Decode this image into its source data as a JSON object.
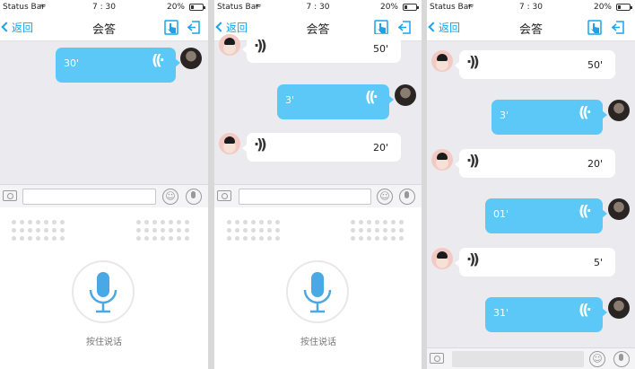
{
  "status_bar": {
    "carrier": "Status Bar",
    "time": "7 : 30",
    "battery": "20%"
  },
  "nav": {
    "back": "返回",
    "title": "会答"
  },
  "screen1": {
    "messages": [
      {
        "side": "self",
        "duration": "30'"
      }
    ]
  },
  "screen2": {
    "messages": [
      {
        "side": "other",
        "duration": "50'"
      },
      {
        "side": "self",
        "duration": "3'"
      },
      {
        "side": "other",
        "duration": "20'"
      }
    ]
  },
  "screen3": {
    "messages": [
      {
        "side": "other",
        "duration": "50'"
      },
      {
        "side": "self",
        "duration": "3'"
      },
      {
        "side": "other",
        "duration": "20'"
      },
      {
        "side": "self",
        "duration": "01'"
      },
      {
        "side": "other",
        "duration": "5'"
      },
      {
        "side": "self",
        "duration": "31'"
      }
    ]
  },
  "voice_panel": {
    "hold_to_talk": "按住说话"
  },
  "icons": {
    "hand": "hand-pointer-icon",
    "exit": "exit-icon",
    "camera": "camera-icon",
    "emoji": "emoji-icon",
    "mic": "microphone-icon",
    "wave": "sound-wave-icon"
  },
  "colors": {
    "accent": "#1aa3e8",
    "bubble_blue": "#5bc8f7",
    "bubble_white": "#ffffff",
    "background": "#ebebef"
  }
}
